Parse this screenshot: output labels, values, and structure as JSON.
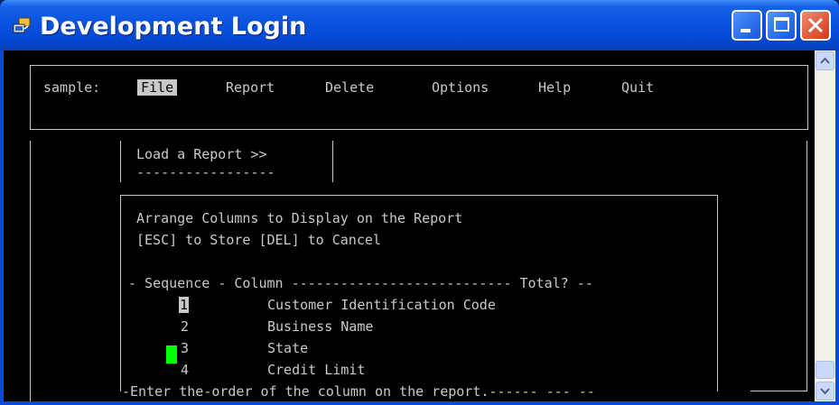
{
  "window": {
    "title": "Development Login"
  },
  "menu": {
    "prefix": "sample:",
    "items": [
      "File",
      "Report",
      "Delete",
      "Options",
      "Help",
      "Quit"
    ]
  },
  "submenu": {
    "item": "Load a Report >>",
    "underline": "-----------------"
  },
  "dialog": {
    "line1": "Arrange Columns to Display on the Report",
    "line2": "[ESC] to Store [DEL] to Cancel",
    "header": "- Sequence - Column --------------------------- Total? --",
    "rows": [
      {
        "seq": "1",
        "column": "Customer Identification Code"
      },
      {
        "seq": "2",
        "column": "Business Name"
      },
      {
        "seq": "3",
        "column": "State"
      },
      {
        "seq": "4",
        "column": "Credit Limit"
      }
    ],
    "footer": "-Enter the-order of the column on the report.------ --- --"
  },
  "colors": {
    "title_bar": "#0349d6",
    "terminal_bg": "#000000",
    "terminal_fg": "#c8c8c8",
    "cursor": "#00ff00",
    "close_button": "#d03a1a"
  }
}
